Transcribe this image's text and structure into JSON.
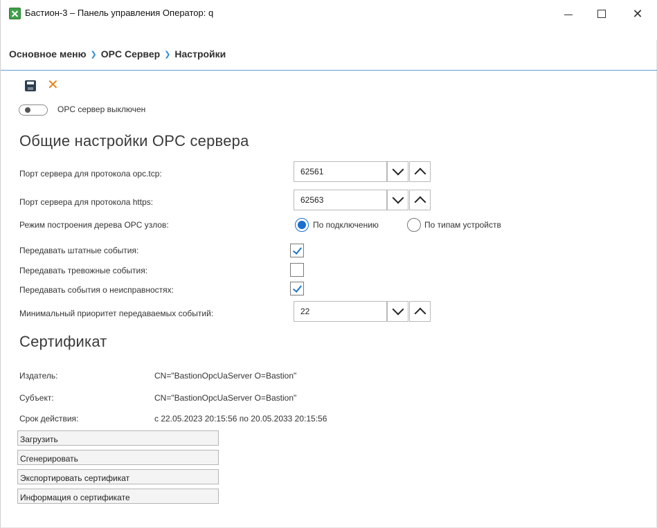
{
  "window": {
    "title": "Бастион-3 – Панель управления Оператор: q",
    "minimize_label": "",
    "close_glyph": "✕"
  },
  "breadcrumb": {
    "items": [
      "Основное меню",
      "OPC Сервер",
      "Настройки"
    ],
    "separator": "❯"
  },
  "toolbar": {
    "save_icon": "save-icon",
    "cancel_icon": "cancel-icon",
    "cancel_glyph": "✕"
  },
  "server_toggle": {
    "state": "off",
    "label": "OPC сервер выключен"
  },
  "general": {
    "title": "Общие настройки OPC сервера",
    "tcp_port": {
      "label": "Порт сервера для протокола opc.tcp:",
      "value": "62561"
    },
    "https_port": {
      "label": "Порт сервера для протокола https:",
      "value": "62563"
    },
    "tree_mode": {
      "label": "Режим построения дерева OPC узлов:",
      "options": [
        "По подключению",
        "По типам устройств"
      ],
      "selected": "По подключению"
    },
    "send_regular": {
      "label": "Передавать штатные события:",
      "checked": true
    },
    "send_alarm": {
      "label": "Передавать тревожные события:",
      "checked": false
    },
    "send_fault": {
      "label": "Передавать события о неисправностях:",
      "checked": true
    },
    "min_priority": {
      "label": "Минимальный приоритет передаваемых событий:",
      "value": "22"
    }
  },
  "certificate": {
    "title": "Сертификат",
    "issuer_label": "Издатель:",
    "issuer_value": "CN=\"BastionOpcUaServer O=Bastion\"",
    "subject_label": "Субъект:",
    "subject_value": "CN=\"BastionOpcUaServer O=Bastion\"",
    "validity_label": "Срок действия:",
    "validity_value": "с 22.05.2023 20:15:56 по 20.05.2033 20:15:56",
    "buttons": [
      "Загрузить",
      "Сгенерировать",
      "Экспортировать сертификат",
      "Информация о сертификате"
    ]
  },
  "colors": {
    "accent": "#1a6fd0",
    "breadcrumb_sep": "#2f8fd6",
    "cancel": "#e8811a"
  }
}
